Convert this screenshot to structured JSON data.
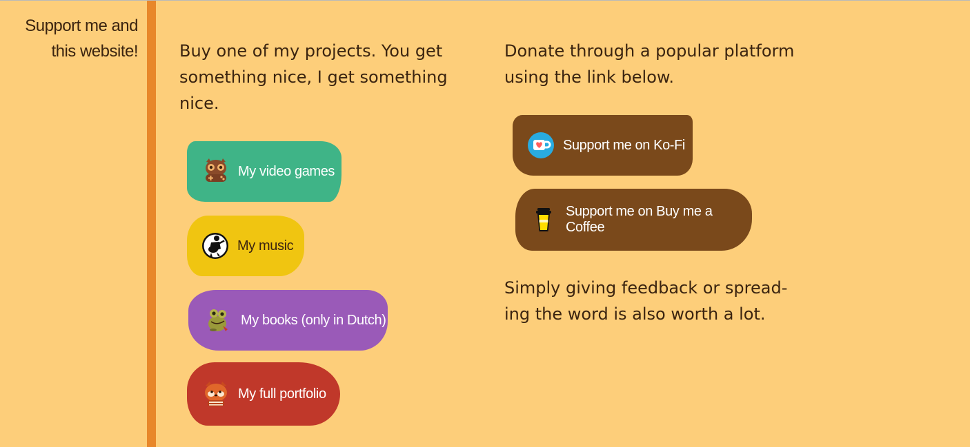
{
  "side_label": {
    "line1": "Support me and",
    "line2": "this website!"
  },
  "col1": {
    "intro": "Buy one of my projects. You get something nice, I get something nice."
  },
  "col2": {
    "intro": "Donate through a popular platform using the link below.",
    "feedback": "Simply giving feedback or spread-ing the word is also worth a lot."
  },
  "project_buttons": [
    {
      "label": "My video games",
      "icon": "owl-gamepad-icon",
      "color": "#3fb487"
    },
    {
      "label": "My music",
      "icon": "guitarist-icon",
      "color": "#f0c511"
    },
    {
      "label": "My books (only in Dutch)",
      "icon": "frog-icon",
      "color": "#9a5ab8"
    },
    {
      "label": "My full portfolio",
      "icon": "red-panda-icon",
      "color": "#c0382a"
    }
  ],
  "donate_buttons": [
    {
      "label": "Support me on Ko-Fi",
      "icon": "kofi-cup-icon",
      "color": "#7a491b"
    },
    {
      "label": "Support me on Buy me a Coffee",
      "icon": "coffee-cup-icon",
      "color": "#7a491b"
    }
  ],
  "colors": {
    "background": "#fdce7a",
    "divider": "#e8872a",
    "text": "#3b2410"
  }
}
